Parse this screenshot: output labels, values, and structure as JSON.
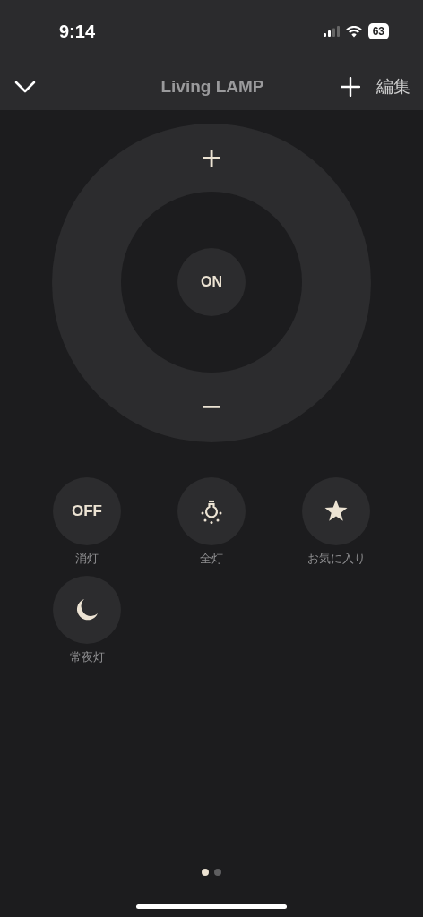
{
  "status_bar": {
    "time": "9:14",
    "battery": "63"
  },
  "nav": {
    "title": "Living LAMP",
    "edit": "編集"
  },
  "dial": {
    "plus": "+",
    "center": "ON",
    "minus": "−"
  },
  "buttons": [
    {
      "kind": "text",
      "icon_text": "OFF",
      "label": "消灯"
    },
    {
      "kind": "bulb",
      "label": "全灯"
    },
    {
      "kind": "star",
      "label": "お気に入り"
    },
    {
      "kind": "moon",
      "label": "常夜灯"
    }
  ],
  "pages": [
    {
      "selected": true
    },
    {
      "selected": false
    }
  ]
}
